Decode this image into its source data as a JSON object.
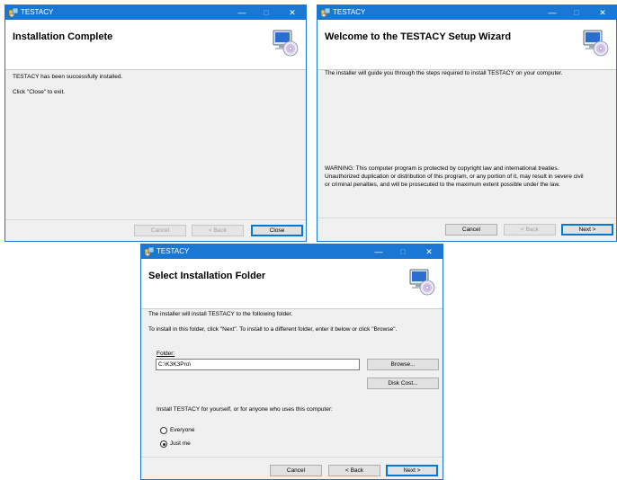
{
  "windows": {
    "complete": {
      "app_title": "TESTACY",
      "controls": {
        "minimize": "—",
        "maximize": "□",
        "close": "✕"
      },
      "heading": "Installation Complete",
      "lines": [
        "TESTACY has been successfully installed.",
        "Click \"Close\" to exit."
      ],
      "buttons": {
        "cancel": "Cancel",
        "back": "< Back",
        "close": "Close"
      }
    },
    "welcome": {
      "app_title": "TESTACY",
      "controls": {
        "minimize": "—",
        "maximize": "□",
        "close": "✕"
      },
      "heading": "Welcome to the TESTACY Setup Wizard",
      "intro": "The installer will guide you through the steps required to install TESTACY on your computer.",
      "warning": [
        "WARNING: This computer program is protected by copyright law and international treaties.",
        "Unauthorized duplication or distribution of this program, or any portion of it, may result in severe civil",
        "or criminal penalties, and will be prosecuted to the maximum extent possible under the law."
      ],
      "buttons": {
        "cancel": "Cancel",
        "back": "< Back",
        "next": "Next >"
      }
    },
    "folder": {
      "app_title": "TESTACY",
      "controls": {
        "minimize": "—",
        "maximize": "□",
        "close": "✕"
      },
      "heading": "Select Installation Folder",
      "lines": [
        "The installer will install TESTACY to the following folder.",
        "To install in this folder, click \"Next\". To install to a different folder, enter it below or click \"Browse\"."
      ],
      "folder_label": "Folder:",
      "folder_value": "C:\\K3K3Pro\\",
      "browse_label": "Browse...",
      "disk_cost_label": "Disk Cost...",
      "scope_question": "Install TESTACY for yourself, or for anyone who uses this computer:",
      "options": [
        {
          "label": "Everyone",
          "selected": false
        },
        {
          "label": "Just me",
          "selected": true
        }
      ],
      "buttons": {
        "cancel": "Cancel",
        "back": "< Back",
        "next": "Next >"
      }
    }
  }
}
